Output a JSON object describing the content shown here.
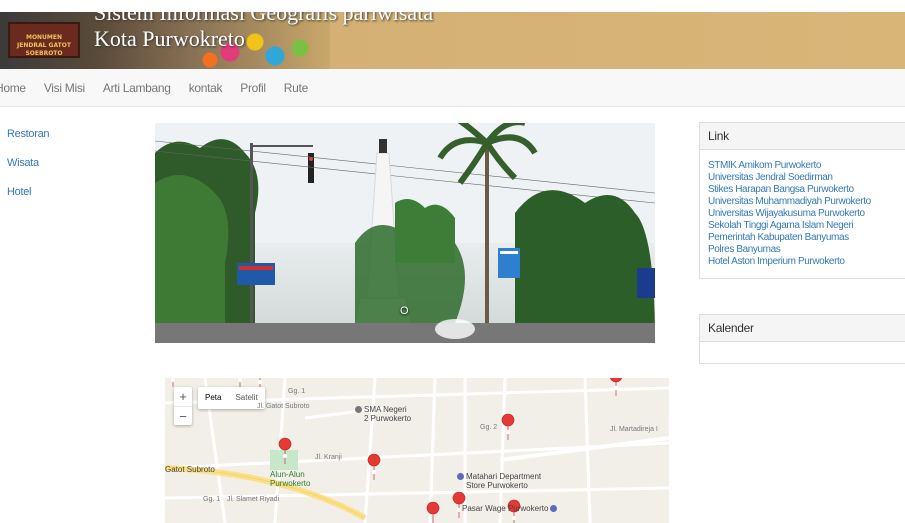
{
  "header": {
    "title_line1": "Sistem Informasi Geografis pariwisata",
    "title_line2": "Kota Purwokreto",
    "sign_line1": "MONUMEN",
    "sign_line2": "JENDRAL GATOT SOEBROTO"
  },
  "nav": {
    "items": [
      "Home",
      "Visi Misi",
      "Arti Lambang",
      "kontak",
      "Profil",
      "Rute"
    ]
  },
  "sidebar": {
    "items": [
      "Restoran",
      "Wisata",
      "Hotel"
    ]
  },
  "carousel": {
    "caption": "O"
  },
  "map": {
    "zoom_in": "+",
    "zoom_out": "−",
    "type_map": "Peta",
    "type_satellite": "Satelit",
    "labels": {
      "sma": "SMA Negeri",
      "sma2": "2 Purwokerto",
      "alun": "Alun-Alun",
      "alun2": "Purwokerto",
      "matahari": "Matahari Department",
      "matahari2": "Store Purwokerto",
      "pasar": "Pasar Wage Purwokerto",
      "gatot": "Gatot Subroto",
      "jl_gatot": "Jl. Gatot Subroto",
      "gg1": "Gg. 1",
      "gg2": "Gg. 2",
      "jl_kranji": "Jl. Kranji",
      "jl_martadireja": "Jl. Martadireja I",
      "jl_stasiun_riyadi": "Jl. Slamet Riyadi"
    },
    "pin_color": "#e53935"
  },
  "link_panel": {
    "title": "Link",
    "links": [
      "STMIK Amikom Purwokerto",
      "Universitas Jendral Soedirman",
      "Stikes Harapan Bangsa Purwokerto",
      "Universitas Muhammadiyah Purwokerto",
      "Universitas Wijayakusuma Purwokerto",
      "Sekolah Tinggi Agama Islam Negeri",
      "Pemerintah Kabupaten Banyumas",
      "Polres Banyumas",
      "Hotel Aston Imperium Purwokerto"
    ]
  },
  "calendar_panel": {
    "title": "Kalender"
  }
}
